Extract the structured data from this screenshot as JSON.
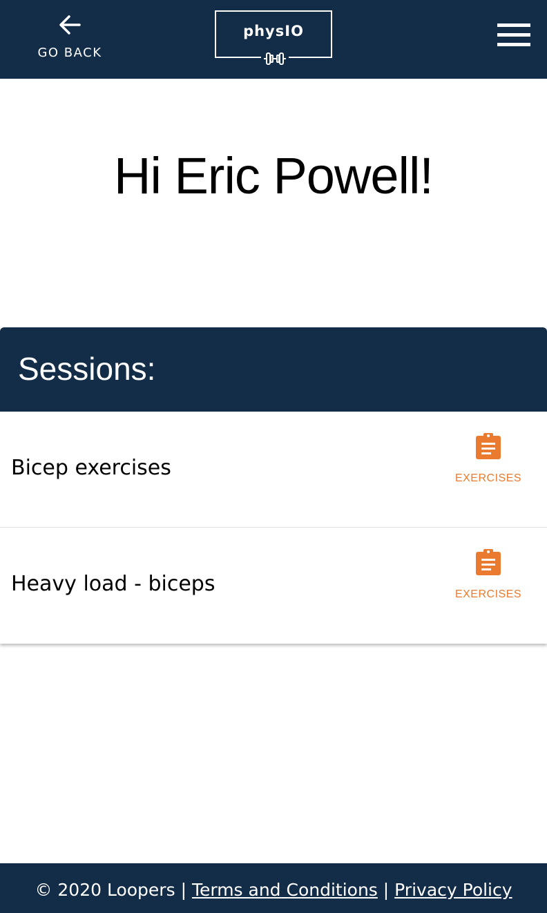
{
  "header": {
    "back_label": "GO BACK",
    "logo_text": "physIO",
    "colors": {
      "bar": "#132c47",
      "text": "#ffffff"
    }
  },
  "main": {
    "greeting": "Hi Eric Powell!"
  },
  "sessions": {
    "title": "Sessions:",
    "items": [
      {
        "name": "Bicep exercises",
        "action_label": "EXERCISES",
        "action_icon": "clipboard-icon"
      },
      {
        "name": "Heavy load - biceps",
        "action_label": "EXERCISES",
        "action_icon": "clipboard-icon"
      }
    ],
    "accent_color": "#ea7a2f"
  },
  "footer": {
    "copyright": "© 2020 Loopers",
    "separator": "|",
    "terms_label": "Terms and Conditions",
    "privacy_label": "Privacy Policy"
  }
}
